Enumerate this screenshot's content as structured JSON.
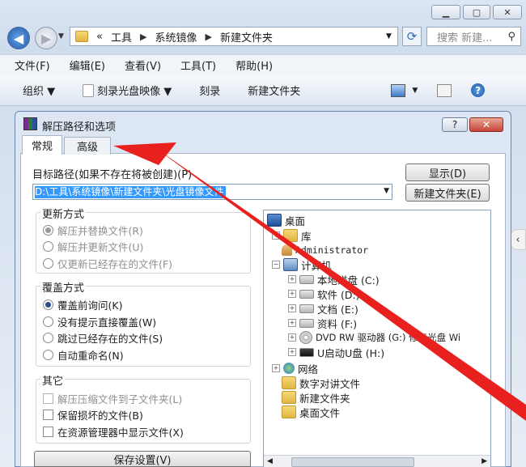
{
  "explorer": {
    "breadcrumb": [
      "«",
      "工具",
      "系统镜像",
      "新建文件夹"
    ],
    "search_placeholder": "搜索 新建...",
    "menu": [
      "文件(F)",
      "编辑(E)",
      "查看(V)",
      "工具(T)",
      "帮助(H)"
    ],
    "toolbar": [
      "组织 ▼",
      "刻录光盘映像 ▼",
      "刻录",
      "新建文件夹"
    ]
  },
  "dialog": {
    "title": "解压路径和选项",
    "help_label": "?",
    "close_label": "✕",
    "tabs": [
      "常规",
      "高级"
    ],
    "target_label": "目标路径(如果不存在将被创建)(P)",
    "target_value": "D:\\工具\\系统镜像\\新建文件夹\\光盘镜像文件",
    "show_button": "显示(D)",
    "new_folder_button": "新建文件夹(E)",
    "update": {
      "title": "更新方式",
      "options": [
        "解压并替换文件(R)",
        "解压并更新文件(U)",
        "仅更新已经存在的文件(F)"
      ]
    },
    "overwrite": {
      "title": "覆盖方式",
      "options": [
        "覆盖前询问(K)",
        "没有提示直接覆盖(W)",
        "跳过已经存在的文件(S)",
        "自动重命名(N)"
      ]
    },
    "misc": {
      "title": "其它",
      "options": [
        "解压压缩文件到子文件夹(L)",
        "保留损坏的文件(B)",
        "在资源管理器中显示文件(X)"
      ]
    },
    "save_button": "保存设置(V)",
    "tree": [
      "桌面",
      "库",
      "Administrator",
      "计算机",
      "本地磁盘 (C:)",
      "软件 (D:)",
      "文档 (E:)",
      "资料 (F:)",
      "DVD RW 驱动器 (G:) 修复光盘 Wi",
      "U启动U盘 (H:)",
      "网络",
      "数字对讲文件",
      "新建文件夹",
      "桌面文件"
    ]
  },
  "colors": {
    "arrow": "#e8211f",
    "selection": "#3399ff",
    "title_bar": "#dde7f3"
  }
}
